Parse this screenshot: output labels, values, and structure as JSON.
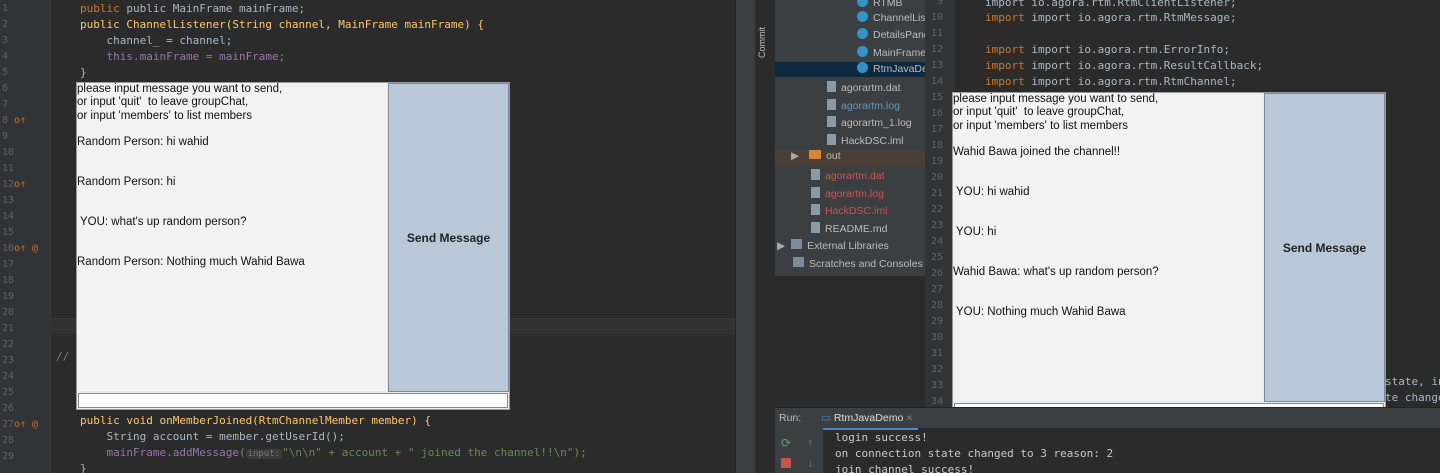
{
  "left_editor": {
    "line_numbers": [
      "1",
      "2",
      "3",
      "4",
      "5",
      "6",
      "7",
      "8",
      "9",
      "10",
      "11",
      "12",
      "13",
      "14",
      "15",
      "16",
      "17",
      "18",
      "19",
      "20",
      "21",
      "22",
      "23",
      "24",
      "25",
      "26",
      "27",
      "28",
      "29",
      "30"
    ],
    "code_lines": [
      "public MainFrame mainFrame;",
      "public ChannelListener(String channel, MainFrame mainFrame) {",
      "    channel_ = channel;",
      "    this.mainFrame = mainFrame;",
      "}",
      "//",
      "public void onMemberJoined(RtmChannelMember member) {",
      "    String account = member.getUserId();",
      "    mainFrame.addMessage(",
      "input:",
      "\"\\n\\n\" + account + \" joined the channel!!\\n\");",
      "}"
    ]
  },
  "left_chat_window": {
    "messages": "please input message you want to send,\nor input 'quit'  to leave groupChat,\nor input 'members' to list members\n\nRandom Person: hi wahid\n\n\nRandom Person: hi\n\n\n YOU: what's up random person?\n\n\nRandom Person: Nothing much Wahid Bawa",
    "send_button": "Send Message",
    "input_value": ""
  },
  "project_tree": {
    "side_tab": "Commit",
    "items": [
      {
        "label": "RTMB",
        "kind": "class"
      },
      {
        "label": "ChannelLis",
        "kind": "class"
      },
      {
        "label": "DetailsPane",
        "kind": "class"
      },
      {
        "label": "MainFrame",
        "kind": "class"
      },
      {
        "label": "RtmJavaDe",
        "kind": "class",
        "selected": true
      },
      {
        "label": "agorartm.dat",
        "kind": "file"
      },
      {
        "label": "agorartm.log",
        "kind": "file"
      },
      {
        "label": "agorartm_1.log",
        "kind": "file"
      },
      {
        "label": "HackDSC.iml",
        "kind": "file"
      },
      {
        "label": "out",
        "kind": "folder"
      },
      {
        "label": "agorartm.dat",
        "kind": "file"
      },
      {
        "label": "agorartm.log",
        "kind": "file"
      },
      {
        "label": "HackDSC.iml",
        "kind": "file"
      },
      {
        "label": "README.md",
        "kind": "file"
      },
      {
        "label": "External Libraries",
        "kind": "lib"
      },
      {
        "label": "Scratches and Consoles",
        "kind": "lib"
      }
    ]
  },
  "right_editor": {
    "line_numbers": [
      "9",
      "10",
      "11",
      "12",
      "13",
      "14",
      "15",
      "16",
      "17",
      "18",
      "19",
      "20",
      "21",
      "22",
      "23",
      "24",
      "25",
      "26",
      "27",
      "28",
      "29",
      "30",
      "31",
      "32",
      "33",
      "34"
    ],
    "code_lines": [
      "import io.agora.rtm.RtmClientListener;",
      "import io.agora.rtm.RtmMessage;",
      "import io.agora.rtm.ErrorInfo;",
      "import io.agora.rtm.ResultCallback;",
      "import io.agora.rtm.RtmChannel;",
      "state, in",
      "te change"
    ]
  },
  "right_chat_window": {
    "messages": "please input message you want to send,\nor input 'quit'  to leave groupChat,\nor input 'members' to list members\n\nWahid Bawa joined the channel!!\n\n\n YOU: hi wahid\n\n\n YOU: hi\n\n\nWahid Bawa: what's up random person?\n\n\n YOU: Nothing much Wahid Bawa",
    "send_button": "Send Message",
    "input_value": ""
  },
  "run_panel": {
    "label": "Run:",
    "tab_name": "RtmJavaDemo",
    "close": "×",
    "output": [
      "login success!",
      "on connection state changed to 3 reason: 2",
      "join channel success!"
    ]
  }
}
